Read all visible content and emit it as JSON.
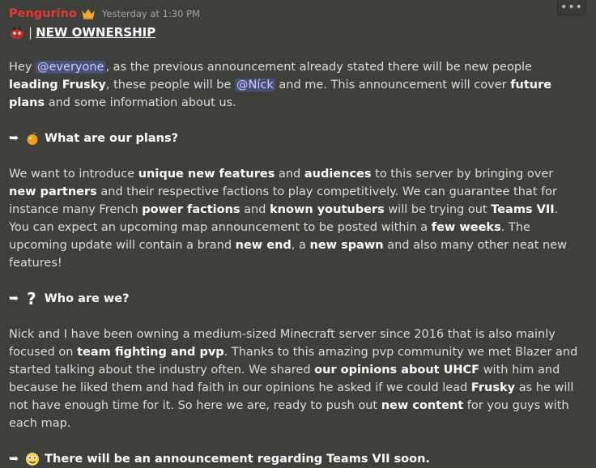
{
  "message": {
    "username": "Pengurino",
    "timestamp": "Yesterday at 1:30 PM",
    "title_sep": "|",
    "title": "NEW OWNERSHIP",
    "intro": {
      "t1": "Hey ",
      "mention_everyone": "@everyone",
      "t2": ", as the previous announcement already stated there will be new people ",
      "b1": "leading Frusky",
      "t3": ", these people will be ",
      "mention_nick": "@Níck",
      "t4": " and me. This announcement will cover ",
      "b2": "future plans",
      "t5": " and some information about us."
    },
    "section1": {
      "arrow": "➥",
      "heading": "What are our plans?",
      "t1": "We want to introduce ",
      "b1": "unique new features",
      "t2": " and ",
      "b2": "audiences",
      "t3": " to this server by bringing over ",
      "b3": "new partners",
      "t4": " and their respective factions to play competitively. We can guarantee that for instance many French ",
      "b4": "power factions",
      "t5": " and ",
      "b5": "known youtubers",
      "t6": " will be trying out ",
      "b6": "Teams VII",
      "t7": ". You can expect an upcoming map announcement to be posted within a ",
      "b7": "few weeks",
      "t8": ". The upcoming update will contain a brand ",
      "b8": "new end",
      "t9": ", a ",
      "b9": "new spawn",
      "t10": " and also many other neat new features!"
    },
    "section2": {
      "arrow": "➥",
      "emoji": "?",
      "heading": "Who are we?",
      "t1": "Nick and I have been owning a medium-sized Minecraft server since 2016 that is also mainly focused on ",
      "b1": "team fighting and pvp",
      "t2": ". Thanks to this amazing pvp community we met Blazer and started talking about the industry often. We shared ",
      "b2": "our opinions about UHCF",
      "t3": " with him and because he liked them and had faith in our opinions he asked if we could lead ",
      "b3": "Frusky",
      "t4": " as he will not have enough time for it. So here we are, ready to push out ",
      "b4": "new content",
      "t5": " for you guys with each map."
    },
    "section3": {
      "arrow": "➥",
      "heading": "There will be an announcement regarding Teams VII soon."
    }
  },
  "toolbar": {
    "more_label": "•••"
  },
  "colors": {
    "background": "#3f3f3b",
    "username": "#e03b3b",
    "mention_bg": "#4a4f79",
    "mention_text": "#c9cdfb"
  }
}
